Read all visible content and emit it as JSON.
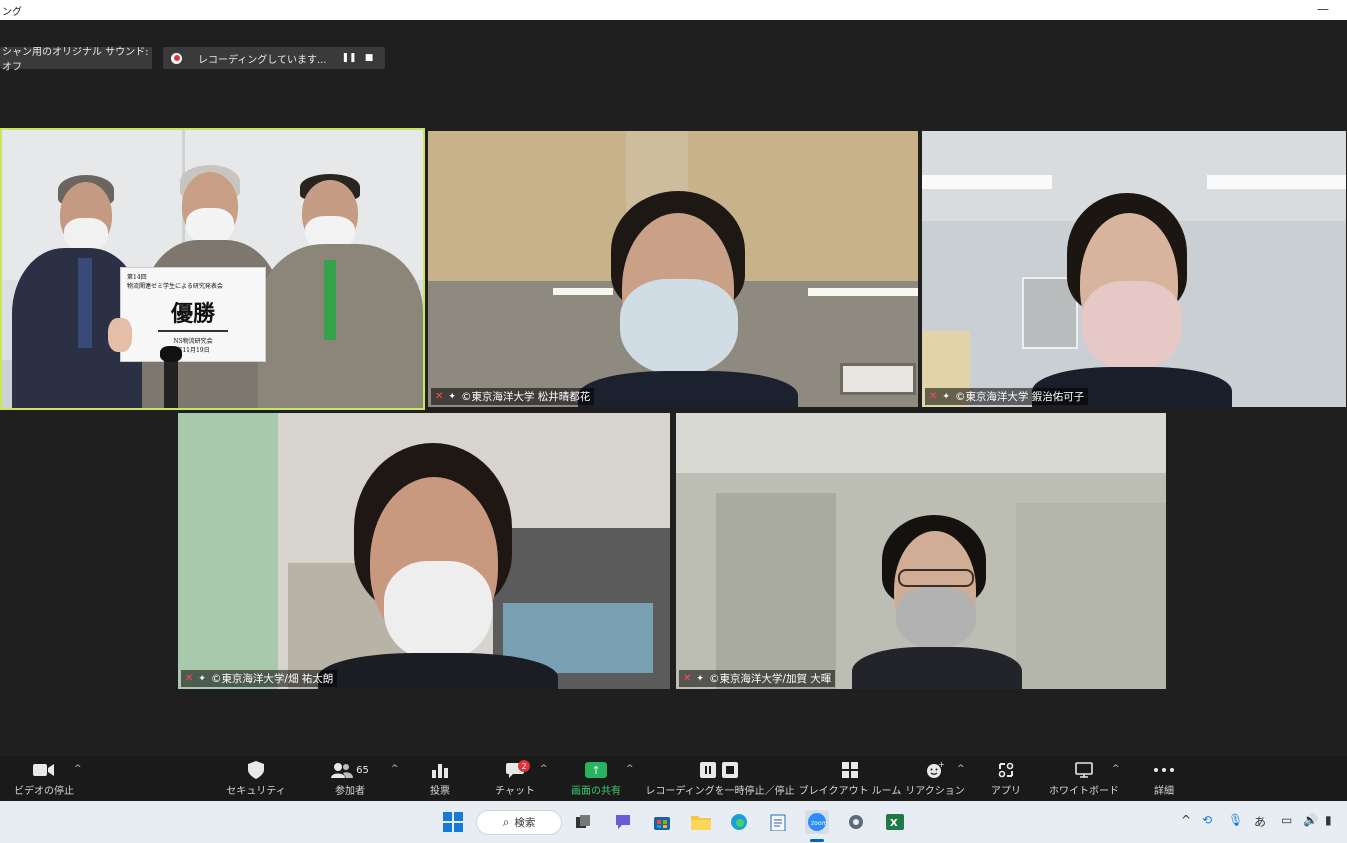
{
  "window": {
    "title_fragment": "ング",
    "minimize_glyph": "—"
  },
  "top_bar": {
    "sound_label": "シャン用のオリジナル サウンド: オフ",
    "recording_label": "レコーディングしています...",
    "pause_glyph": "❚❚",
    "stop_glyph": "■"
  },
  "tiles": [
    {
      "id": "tile-1",
      "name": "",
      "active": true,
      "sign": {
        "line1": "第14回",
        "line2": "物流関連ゼミ学生による研究発表会",
        "big": "優勝",
        "line3": "NS物流研究会",
        "line4": "年11月19日"
      }
    },
    {
      "id": "tile-2",
      "name": "©東京海洋大学 松井晴都花"
    },
    {
      "id": "tile-3",
      "name": "©東京海洋大学 鍜治佑可子"
    },
    {
      "id": "tile-4",
      "name": "©東京海洋大学/畑 祐太朗"
    },
    {
      "id": "tile-5",
      "name": "©東京海洋大学/加賀 大暉"
    }
  ],
  "toolbar": {
    "video": "ビデオの停止",
    "security": "セキュリティ",
    "participants": "参加者",
    "participants_count": "65",
    "poll": "投票",
    "chat": "チャット",
    "chat_badge": "2",
    "share": "画面の共有",
    "recording": "レコーディングを一時停止／停止",
    "breakout": "ブレイクアウト ルーム",
    "reactions": "リアクション",
    "apps": "アプリ",
    "whiteboard": "ホワイトボード",
    "more": "詳細"
  },
  "taskbar": {
    "search_label": "検索",
    "ime": "あ"
  },
  "colors": {
    "active_speaker": "#c8e65a",
    "share_green": "#27b35f",
    "record_red": "#e0323a",
    "toolbar_bg": "#1a1a1a",
    "taskbar_bg": "#e8edf3"
  }
}
